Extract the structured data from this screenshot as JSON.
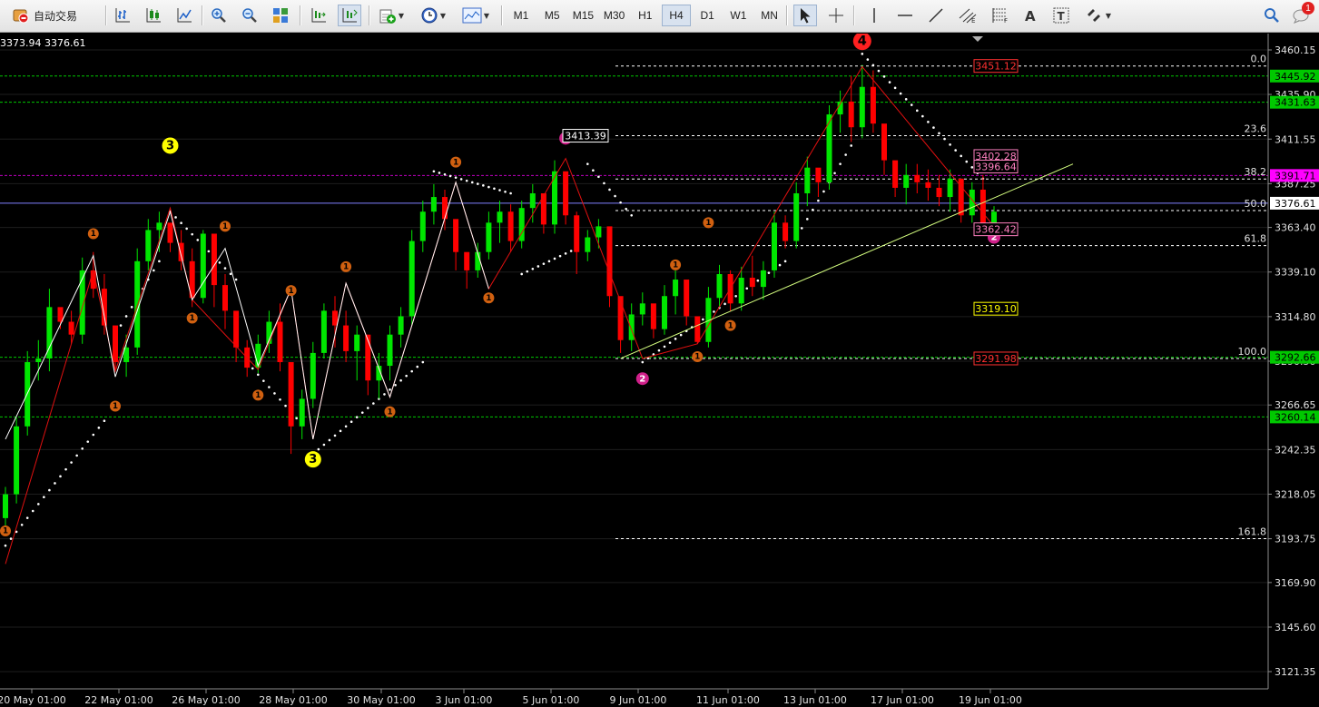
{
  "toolbar": {
    "autotrade_label": "自动交易",
    "timeframes": [
      "M1",
      "M5",
      "M15",
      "M30",
      "H1",
      "H4",
      "D1",
      "W1",
      "MN"
    ],
    "active_timeframe": "H4",
    "notification_count": "1"
  },
  "chart_header": {
    "quote_text": "3373.94 3376.61"
  },
  "colors": {
    "bull": "#00e600",
    "bear": "#ff0000",
    "background": "#000000",
    "grid": "#1e1e1e",
    "fib": "#ffffff",
    "trendline": "#d5ff80",
    "label_green": "#00c800",
    "label_magenta": "#ff00ff"
  },
  "chart_data": {
    "type": "candlestick",
    "symbol_quote": "3373.94 3376.61",
    "ylim": [
      3110,
      3470
    ],
    "y_ticks": [
      "3460.15",
      "3435.90",
      "3411.55",
      "3387.25",
      "3363.40",
      "3339.10",
      "3314.80",
      "3290.50",
      "3266.65",
      "3242.35",
      "3218.05",
      "3193.75",
      "3169.90",
      "3145.60",
      "3121.35"
    ],
    "x_tick_labels": [
      "20 May 01:00",
      "22 May 01:00",
      "26 May 01:00",
      "28 May 01:00",
      "30 May 01:00",
      "3 Jun 01:00",
      "5 Jun 01:00",
      "9 Jun 01:00",
      "11 Jun 01:00",
      "13 Jun 01:00",
      "17 Jun 01:00",
      "19 Jun 01:00"
    ],
    "current_price": 3376.61,
    "price_tags": [
      {
        "value": "3445.92",
        "price": 3445.92,
        "style": "green"
      },
      {
        "value": "3431.63",
        "price": 3431.63,
        "style": "green"
      },
      {
        "value": "3391.71",
        "price": 3391.71,
        "style": "magenta"
      },
      {
        "value": "3376.61",
        "price": 3376.61,
        "style": "white"
      },
      {
        "value": "3292.66",
        "price": 3292.66,
        "style": "green"
      },
      {
        "value": "3260.14",
        "price": 3260.14,
        "style": "green"
      }
    ],
    "fibonacci": [
      {
        "level": "0.0",
        "price": 3451.4
      },
      {
        "level": "23.6",
        "price": 3413.4
      },
      {
        "level": "38.2",
        "price": 3389.8
      },
      {
        "level": "50.0",
        "price": 3372.6
      },
      {
        "level": "61.8",
        "price": 3353.5
      },
      {
        "level": "100.0",
        "price": 3292.0
      },
      {
        "level": "161.8",
        "price": 3193.8
      }
    ],
    "level_boxes": [
      {
        "text": "3451.12",
        "price": 3451.4,
        "color": "#ff3030"
      },
      {
        "text": "3402.28",
        "price": 3402.3,
        "color": "#ff80c0"
      },
      {
        "text": "3396.64",
        "price": 3396.6,
        "color": "#ff80c0"
      },
      {
        "text": "3362.42",
        "price": 3362.4,
        "color": "#ff80c0"
      },
      {
        "text": "3319.10",
        "price": 3319.1,
        "color": "#ffff00"
      },
      {
        "text": "3291.98",
        "price": 3292.0,
        "color": "#ff3030"
      }
    ],
    "annotation_3413": "3413.39",
    "horizontal_lines": [
      {
        "price": 3445.92,
        "color": "#00c800",
        "style": "dash"
      },
      {
        "price": 3431.63,
        "color": "#00c800",
        "style": "dash"
      },
      {
        "price": 3391.71,
        "color": "#c000c0",
        "style": "dash"
      },
      {
        "price": 3376.61,
        "color": "#8080ff",
        "style": "solid"
      },
      {
        "price": 3292.66,
        "color": "#00c800",
        "style": "dash"
      },
      {
        "price": 3260.14,
        "color": "#00c800",
        "style": "dash"
      }
    ],
    "wave_markers": [
      {
        "label": "4",
        "color": "#ff2020",
        "text": "#000",
        "r": 10,
        "index": 78,
        "price": 3465
      },
      {
        "label": "3",
        "color": "#ffff00",
        "text": "#000",
        "r": 9,
        "index": 15,
        "price": 3408
      },
      {
        "label": "3",
        "color": "#ffff00",
        "text": "#000",
        "r": 9,
        "index": 28,
        "price": 3237
      },
      {
        "label": "2",
        "color": "#d0208a",
        "text": "#fff",
        "r": 7,
        "index": 51,
        "price": 3412
      },
      {
        "label": "2",
        "color": "#d0208a",
        "text": "#fff",
        "r": 7,
        "index": 58,
        "price": 3281
      },
      {
        "label": "2",
        "color": "#d0208a",
        "text": "#fff",
        "r": 7,
        "index": 90,
        "price": 3358
      },
      {
        "label": "1",
        "color": "#d06010",
        "text": "#000",
        "r": 6,
        "index": 0,
        "price": 3198
      },
      {
        "label": "1",
        "color": "#d06010",
        "text": "#000",
        "r": 6,
        "index": 8,
        "price": 3360
      },
      {
        "label": "1",
        "color": "#d06010",
        "text": "#000",
        "r": 6,
        "index": 10,
        "price": 3266
      },
      {
        "label": "1",
        "color": "#d06010",
        "text": "#000",
        "r": 6,
        "index": 17,
        "price": 3314
      },
      {
        "label": "1",
        "color": "#d06010",
        "text": "#000",
        "r": 6,
        "index": 20,
        "price": 3364
      },
      {
        "label": "1",
        "color": "#d06010",
        "text": "#000",
        "r": 6,
        "index": 23,
        "price": 3272
      },
      {
        "label": "1",
        "color": "#d06010",
        "text": "#000",
        "r": 6,
        "index": 26,
        "price": 3329
      },
      {
        "label": "1",
        "color": "#d06010",
        "text": "#000",
        "r": 6,
        "index": 31,
        "price": 3342
      },
      {
        "label": "1",
        "color": "#d06010",
        "text": "#000",
        "r": 6,
        "index": 35,
        "price": 3263
      },
      {
        "label": "1",
        "color": "#d06010",
        "text": "#000",
        "r": 6,
        "index": 41,
        "price": 3399
      },
      {
        "label": "1",
        "color": "#d06010",
        "text": "#000",
        "r": 6,
        "index": 44,
        "price": 3325
      },
      {
        "label": "1",
        "color": "#d06010",
        "text": "#000",
        "r": 6,
        "index": 61,
        "price": 3343
      },
      {
        "label": "1",
        "color": "#d06010",
        "text": "#000",
        "r": 6,
        "index": 64,
        "price": 3366
      },
      {
        "label": "1",
        "color": "#d06010",
        "text": "#000",
        "r": 6,
        "index": 63,
        "price": 3293
      },
      {
        "label": "1",
        "color": "#d06010",
        "text": "#000",
        "r": 6,
        "index": 66,
        "price": 3310
      }
    ],
    "candles": [
      [
        3205,
        3222,
        3198,
        3218
      ],
      [
        3218,
        3260,
        3213,
        3255
      ],
      [
        3255,
        3296,
        3250,
        3290
      ],
      [
        3290,
        3302,
        3280,
        3292
      ],
      [
        3292,
        3330,
        3285,
        3320
      ],
      [
        3320,
        3316,
        3308,
        3312
      ],
      [
        3312,
        3318,
        3300,
        3305
      ],
      [
        3305,
        3347,
        3300,
        3340
      ],
      [
        3340,
        3350,
        3325,
        3330
      ],
      [
        3330,
        3338,
        3305,
        3310
      ],
      [
        3310,
        3300,
        3285,
        3290
      ],
      [
        3290,
        3305,
        3282,
        3298
      ],
      [
        3298,
        3352,
        3294,
        3345
      ],
      [
        3345,
        3368,
        3340,
        3362
      ],
      [
        3362,
        3372,
        3350,
        3366
      ],
      [
        3366,
        3364,
        3350,
        3355
      ],
      [
        3355,
        3362,
        3340,
        3345
      ],
      [
        3345,
        3352,
        3320,
        3325
      ],
      [
        3325,
        3362,
        3322,
        3360
      ],
      [
        3360,
        3352,
        3320,
        3332
      ],
      [
        3332,
        3338,
        3308,
        3318
      ],
      [
        3318,
        3312,
        3290,
        3298
      ],
      [
        3298,
        3302,
        3282,
        3287
      ],
      [
        3287,
        3305,
        3284,
        3300
      ],
      [
        3300,
        3318,
        3295,
        3312
      ],
      [
        3312,
        3322,
        3285,
        3290
      ],
      [
        3290,
        3268,
        3240,
        3255
      ],
      [
        3255,
        3275,
        3248,
        3270
      ],
      [
        3270,
        3301,
        3265,
        3295
      ],
      [
        3295,
        3322,
        3292,
        3318
      ],
      [
        3318,
        3326,
        3298,
        3310
      ],
      [
        3310,
        3318,
        3290,
        3296
      ],
      [
        3296,
        3310,
        3280,
        3305
      ],
      [
        3305,
        3300,
        3272,
        3280
      ],
      [
        3280,
        3295,
        3270,
        3288
      ],
      [
        3288,
        3310,
        3280,
        3305
      ],
      [
        3305,
        3320,
        3298,
        3315
      ],
      [
        3315,
        3362,
        3310,
        3356
      ],
      [
        3356,
        3378,
        3350,
        3372
      ],
      [
        3372,
        3387,
        3365,
        3380
      ],
      [
        3380,
        3384,
        3362,
        3368
      ],
      [
        3368,
        3366,
        3340,
        3350
      ],
      [
        3350,
        3345,
        3330,
        3340
      ],
      [
        3340,
        3355,
        3336,
        3350
      ],
      [
        3350,
        3372,
        3346,
        3366
      ],
      [
        3366,
        3378,
        3355,
        3372
      ],
      [
        3372,
        3376,
        3350,
        3356
      ],
      [
        3356,
        3378,
        3352,
        3374
      ],
      [
        3374,
        3387,
        3366,
        3382
      ],
      [
        3382,
        3376,
        3360,
        3365
      ],
      [
        3365,
        3400,
        3360,
        3394
      ],
      [
        3394,
        3388,
        3365,
        3370
      ],
      [
        3370,
        3372,
        3338,
        3350
      ],
      [
        3350,
        3362,
        3345,
        3358
      ],
      [
        3358,
        3368,
        3352,
        3364
      ],
      [
        3364,
        3350,
        3320,
        3326
      ],
      [
        3326,
        3312,
        3295,
        3302
      ],
      [
        3302,
        3322,
        3296,
        3316
      ],
      [
        3316,
        3328,
        3310,
        3322
      ],
      [
        3322,
        3316,
        3303,
        3308
      ],
      [
        3308,
        3332,
        3305,
        3326
      ],
      [
        3326,
        3340,
        3316,
        3335
      ],
      [
        3335,
        3322,
        3310,
        3315
      ],
      [
        3315,
        3302,
        3300,
        3301
      ],
      [
        3301,
        3331,
        3298,
        3325
      ],
      [
        3325,
        3343,
        3320,
        3338
      ],
      [
        3338,
        3340,
        3318,
        3322
      ],
      [
        3322,
        3342,
        3318,
        3336
      ],
      [
        3336,
        3348,
        3326,
        3331
      ],
      [
        3331,
        3345,
        3324,
        3340
      ],
      [
        3340,
        3372,
        3336,
        3366
      ],
      [
        3366,
        3370,
        3352,
        3356
      ],
      [
        3356,
        3388,
        3352,
        3382
      ],
      [
        3382,
        3402,
        3375,
        3396
      ],
      [
        3396,
        3393,
        3380,
        3388
      ],
      [
        3388,
        3430,
        3384,
        3425
      ],
      [
        3425,
        3438,
        3415,
        3432
      ],
      [
        3432,
        3446,
        3410,
        3418
      ],
      [
        3418,
        3452,
        3412,
        3440
      ],
      [
        3440,
        3449,
        3415,
        3420
      ],
      [
        3420,
        3415,
        3392,
        3400
      ],
      [
        3400,
        3395,
        3380,
        3385
      ],
      [
        3385,
        3398,
        3376,
        3392
      ],
      [
        3392,
        3398,
        3382,
        3388
      ],
      [
        3388,
        3395,
        3378,
        3385
      ],
      [
        3385,
        3392,
        3375,
        3380
      ],
      [
        3380,
        3395,
        3372,
        3390
      ],
      [
        3390,
        3388,
        3366,
        3370
      ],
      [
        3370,
        3388,
        3366,
        3384
      ],
      [
        3384,
        3392,
        3362,
        3365
      ],
      [
        3365,
        3375,
        3362,
        3372
      ]
    ],
    "psar_dots": [
      {
        "from": 0,
        "to": 9,
        "start": 3190,
        "end": 3258,
        "side": "below"
      },
      {
        "from": 10,
        "to": 14,
        "start": 3305,
        "end": 3345,
        "side": "below"
      },
      {
        "from": 15,
        "to": 21,
        "start": 3372,
        "end": 3335,
        "side": "above"
      },
      {
        "from": 22,
        "to": 27,
        "start": 3290,
        "end": 3256,
        "side": "above"
      },
      {
        "from": 28,
        "to": 38,
        "start": 3240,
        "end": 3290,
        "side": "below"
      },
      {
        "from": 39,
        "to": 46,
        "start": 3394,
        "end": 3382,
        "side": "above"
      },
      {
        "from": 47,
        "to": 52,
        "start": 3338,
        "end": 3352,
        "side": "below"
      },
      {
        "from": 53,
        "to": 57,
        "start": 3398,
        "end": 3370,
        "side": "above"
      },
      {
        "from": 58,
        "to": 71,
        "start": 3290,
        "end": 3345,
        "side": "below"
      },
      {
        "from": 72,
        "to": 77,
        "start": 3358,
        "end": 3408,
        "side": "below"
      },
      {
        "from": 78,
        "to": 89,
        "start": 3458,
        "end": 3390,
        "side": "above"
      }
    ]
  }
}
